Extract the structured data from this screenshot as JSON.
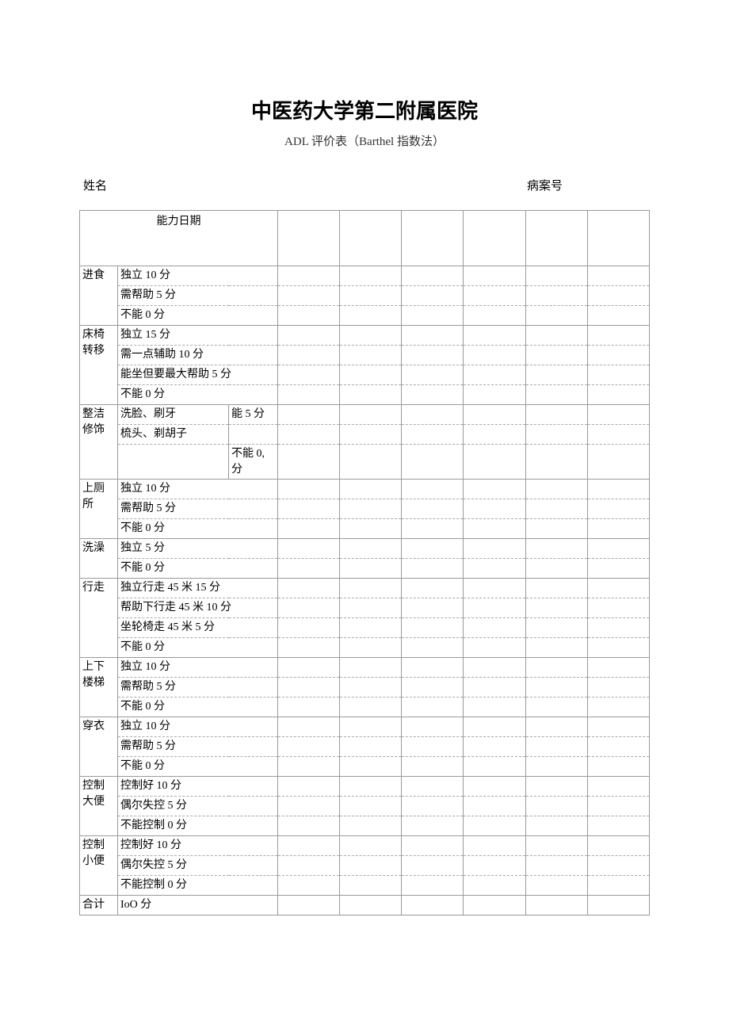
{
  "title": "中医药大学第二附属医院",
  "subtitle": "ADL 评价表（Barthel 指数法）",
  "labels": {
    "name": "姓名",
    "caseNo": "病案号"
  },
  "header": "能力日期",
  "rows": [
    {
      "cat": "进食",
      "items": [
        "独立 10 分",
        "需帮助 5 分",
        "不能 0 分"
      ]
    },
    {
      "cat": "床椅转移",
      "items": [
        "独立 15 分",
        "需一点辅助 10 分",
        "能坐但要最大帮助 5 分",
        "不能 0 分"
      ]
    },
    {
      "cat": "整洁修饰",
      "items_split": [
        {
          "l": "洗脸、刷牙",
          "r": "能 5 分"
        },
        {
          "l": "梳头、剃胡子",
          "r": ""
        },
        {
          "l": "",
          "r": "不能 0,分"
        }
      ]
    },
    {
      "cat": "上厕所",
      "items": [
        "独立 10 分",
        "需帮助 5 分",
        "不能 0 分"
      ]
    },
    {
      "cat": "洗澡",
      "items": [
        "独立 5 分",
        "不能 0 分"
      ]
    },
    {
      "cat": "行走",
      "items": [
        "独立行走 45 米 15 分",
        "帮助下行走 45 米 10 分",
        "坐轮椅走 45 米 5 分",
        "不能 0 分"
      ]
    },
    {
      "cat": "上下楼梯",
      "items": [
        "独立 10 分",
        "需帮助 5 分",
        "不能 0 分"
      ]
    },
    {
      "cat": "穿衣",
      "items": [
        "独立 10 分",
        "需帮助 5 分",
        "不能 0 分"
      ]
    },
    {
      "cat": "控制大便",
      "items": [
        "控制好 10 分",
        "偶尔失控 5 分",
        "不能控制 0 分"
      ]
    },
    {
      "cat": "控制小便",
      "items": [
        "控制好 10 分",
        "偶尔失控 5 分",
        "不能控制 0 分"
      ]
    }
  ],
  "total": {
    "label": "合计",
    "value": "IoO 分"
  }
}
